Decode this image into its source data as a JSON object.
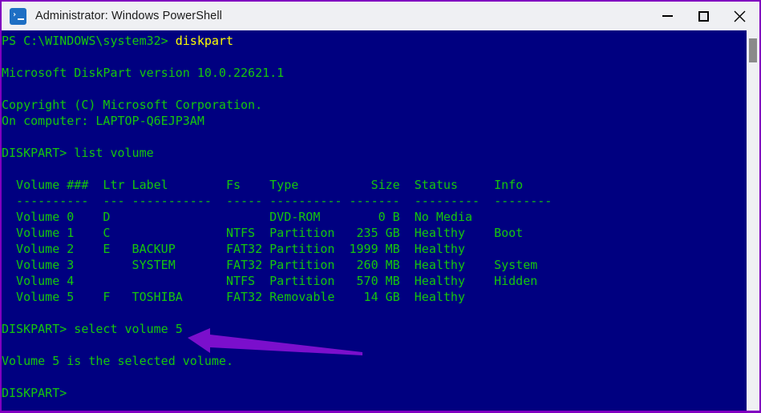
{
  "window": {
    "title": "Administrator: Windows PowerShell",
    "icon": "powershell-icon",
    "prompt_glyph": "›",
    "controls": {
      "minimize": "minimize-button",
      "maximize": "maximize-button",
      "close": "close-button"
    }
  },
  "colors": {
    "console_background": "#000080",
    "console_text": "#16c60c",
    "command_highlight": "#ffff00",
    "titlebar_background": "#eff0f3",
    "window_border": "#8000c0",
    "annotation_arrow": "#7b0fcc",
    "scrollbar_track": "#eff0f3",
    "scrollbar_thumb": "#8a8a8a"
  },
  "console": {
    "prompt_ps": "PS C:\\WINDOWS\\system32>",
    "prompt_diskpart": "DISKPART>",
    "commands": {
      "diskpart": "diskpart",
      "list_volume": "list volume",
      "select_volume": "select volume 5"
    },
    "banner": {
      "version_line": "Microsoft DiskPart version 10.0.22621.1",
      "copyright": "Copyright (C) Microsoft Corporation.",
      "computer": "On computer: LAPTOP-Q6EJP3AM"
    },
    "table": {
      "headers": [
        "Volume ###",
        "Ltr",
        "Label",
        "Fs",
        "Type",
        "Size",
        "Status",
        "Info"
      ],
      "separators": [
        "----------",
        "---",
        "-----------",
        "-----",
        "----------",
        "-------",
        "---------",
        "--------"
      ],
      "rows": [
        {
          "volume": "Volume 0",
          "ltr": "D",
          "label": "",
          "fs": "",
          "type": "DVD-ROM",
          "size": "0 B",
          "status": "No Media",
          "info": ""
        },
        {
          "volume": "Volume 1",
          "ltr": "C",
          "label": "",
          "fs": "NTFS",
          "type": "Partition",
          "size": "235 GB",
          "status": "Healthy",
          "info": "Boot"
        },
        {
          "volume": "Volume 2",
          "ltr": "E",
          "label": "BACKUP",
          "fs": "FAT32",
          "type": "Partition",
          "size": "1999 MB",
          "status": "Healthy",
          "info": ""
        },
        {
          "volume": "Volume 3",
          "ltr": "",
          "label": "SYSTEM",
          "fs": "FAT32",
          "type": "Partition",
          "size": "260 MB",
          "status": "Healthy",
          "info": "System"
        },
        {
          "volume": "Volume 4",
          "ltr": "",
          "label": "",
          "fs": "NTFS",
          "type": "Partition",
          "size": "570 MB",
          "status": "Healthy",
          "info": "Hidden"
        },
        {
          "volume": "Volume 5",
          "ltr": "F",
          "label": "TOSHIBA",
          "fs": "FAT32",
          "type": "Removable",
          "size": "14 GB",
          "status": "Healthy",
          "info": ""
        }
      ]
    },
    "result_message": "Volume 5 is the selected volume."
  },
  "annotation": {
    "arrow": "left-pointing-arrow",
    "points_at": "select volume 5"
  }
}
